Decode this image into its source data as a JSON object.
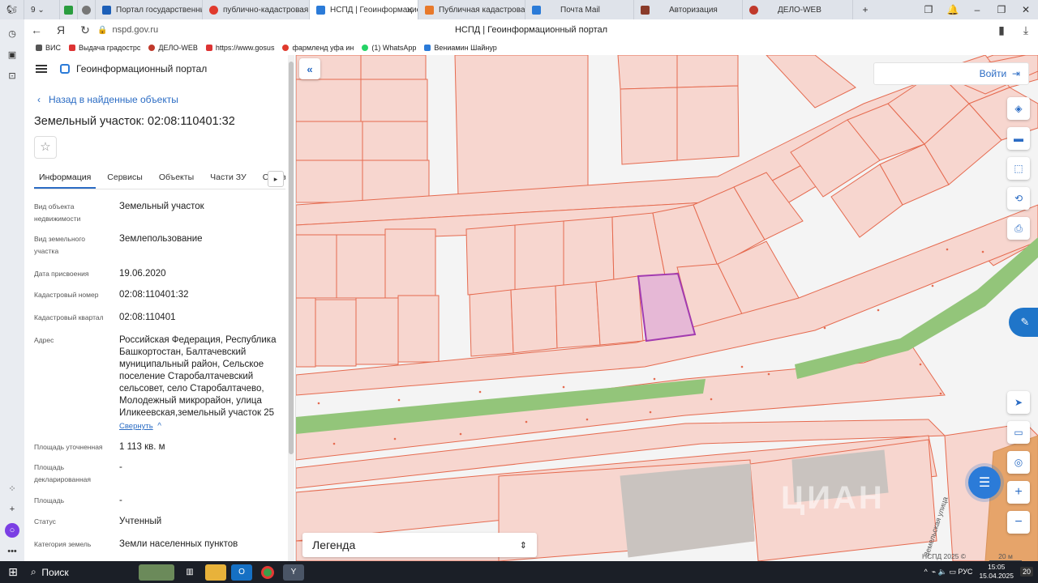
{
  "browser": {
    "tab_count": "9",
    "tabs": [
      {
        "label": "Портал государственных",
        "color": "#1c5fb8"
      },
      {
        "label": "публично-кадастровая ка",
        "color": "#e03a2d"
      },
      {
        "label": "НСПД | Геоинформацио",
        "color": "#2b7bd8",
        "active": true
      },
      {
        "label": "Публичная кадастровая к",
        "color": "#e8792b"
      },
      {
        "label": "Почта Mail",
        "color": "#2b7bd8"
      },
      {
        "label": "Авторизация",
        "color": "#8a3b2a"
      },
      {
        "label": "ДЕЛО-WEB",
        "color": "#c0392b"
      }
    ],
    "new_tab": "+",
    "url": "nspd.gov.ru",
    "page_title": "НСПД | Геоинформационный портал",
    "bookmarks": [
      {
        "label": "ВИС",
        "color": "#555"
      },
      {
        "label": "Выдача градострс",
        "color": "#d33"
      },
      {
        "label": "ДЕЛО-WEB",
        "color": "#c0392b"
      },
      {
        "label": "https://www.gosus",
        "color": "#d33"
      },
      {
        "label": "фармленд уфа ин",
        "color": "#e03a2d"
      },
      {
        "label": "(1) WhatsApp",
        "color": "#25d366"
      },
      {
        "label": "Вениамин Шайнур",
        "color": "#2b7bd8"
      }
    ]
  },
  "panel": {
    "portal_name": "Геоинформационный портал",
    "back_link": "Назад в найденные объекты",
    "title": "Земельный участок: 02:08:110401:32",
    "star": "☆",
    "tabs": [
      "Информация",
      "Сервисы",
      "Объекты",
      "Части ЗУ",
      "Состав"
    ],
    "tab_arrow": "▸",
    "properties": [
      {
        "label": "Вид объекта недвижимости",
        "value": "Земельный участок"
      },
      {
        "label": "Вид земельного участка",
        "value": "Землепользование"
      },
      {
        "label": "Дата присвоения",
        "value": "19.06.2020"
      },
      {
        "label": "Кадастровый номер",
        "value": "02:08:110401:32"
      },
      {
        "label": "Кадастровый квартал",
        "value": "02:08:110401"
      },
      {
        "label": "Адрес",
        "value": "Российская Федерация, Республика Башкортостан, Балтачевский муниципальный район, Сельское поселение Старобалтачевский сельсовет, село Старобалтачево, Молодежный микрорайон, улица Иликеевская,земельный участок 25"
      },
      {
        "label": "Площадь уточненная",
        "value": "1 113 кв. м"
      },
      {
        "label": "Площадь декларированная",
        "value": "-"
      },
      {
        "label": "Площадь",
        "value": "-"
      },
      {
        "label": "Статус",
        "value": "Учтенный"
      },
      {
        "label": "Категория земель",
        "value": "Земли населенных пунктов"
      }
    ],
    "collapse_link": "Свернуть"
  },
  "map": {
    "login_label": "Войти",
    "legend_label": "Легенда",
    "copyright": "НСПД 2025 ©",
    "scale": "20 м",
    "street_label": "Земельская улица",
    "watermark": "ЦИАН",
    "colors": {
      "parcel_fill": "#f7d6cf",
      "parcel_line": "#e56a4f",
      "selected_fill": "#e6b8d6",
      "selected_line": "#a23bb0",
      "green": "#93c57a"
    }
  },
  "taskbar": {
    "search_label": "Поиск",
    "lang": "РУС",
    "time": "15:05",
    "date": "15.04.2025",
    "notifications": "20"
  }
}
